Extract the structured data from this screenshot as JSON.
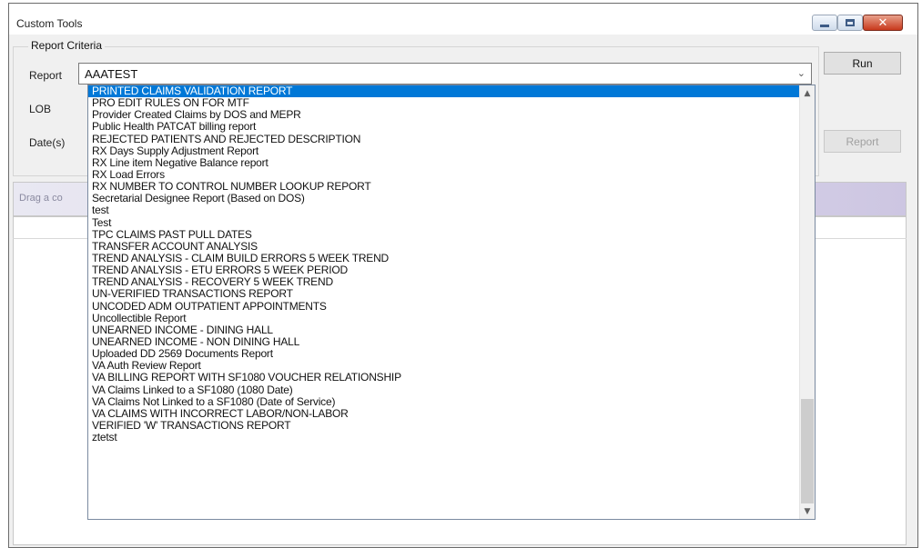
{
  "window": {
    "title": "Custom Tools"
  },
  "criteria": {
    "group_title": "Report Criteria",
    "report_label": "Report",
    "lob_label": "LOB",
    "dates_label": "Date(s)",
    "report_value": "AAATEST"
  },
  "buttons": {
    "run": "Run",
    "report": "Report"
  },
  "grid": {
    "drag_hint": "Drag a co"
  },
  "dropdown": {
    "items": [
      "PRINTED CLAIMS VALIDATION REPORT",
      "PRO EDIT RULES ON FOR MTF",
      "Provider Created Claims by DOS and MEPR",
      "Public Health PATCAT billing report",
      "REJECTED PATIENTS AND REJECTED DESCRIPTION",
      "RX Days Supply Adjustment Report",
      "RX Line item Negative Balance report",
      "RX Load Errors",
      "RX NUMBER TO CONTROL NUMBER LOOKUP REPORT",
      "Secretarial Designee Report (Based on DOS)",
      "test",
      "Test",
      "TPC CLAIMS PAST PULL DATES",
      "TRANSFER ACCOUNT ANALYSIS",
      "TREND ANALYSIS - CLAIM BUILD ERRORS 5 WEEK TREND",
      "TREND ANALYSIS - ETU ERRORS 5 WEEK PERIOD",
      "TREND ANALYSIS - RECOVERY 5 WEEK TREND",
      "UN-VERIFIED TRANSACTIONS REPORT",
      "UNCODED ADM OUTPATIENT APPOINTMENTS",
      "Uncollectible Report",
      "UNEARNED INCOME - DINING HALL",
      "UNEARNED INCOME - NON DINING HALL",
      "Uploaded DD 2569 Documents Report",
      "VA Auth Review Report",
      "VA BILLING REPORT WITH SF1080 VOUCHER RELATIONSHIP",
      "VA Claims Linked to a SF1080 (1080 Date)",
      "VA Claims Not Linked to a SF1080 (Date of Service)",
      "VA CLAIMS WITH INCORRECT LABOR/NON-LABOR",
      "VERIFIED 'W' TRANSACTIONS REPORT",
      "ztetst"
    ],
    "selected_index": 0
  },
  "colors": {
    "selection": "#0078d7",
    "close_button": "#c8381c"
  },
  "icons": {
    "minimize": "minimize-icon",
    "maximize": "maximize-icon",
    "close": "close-icon",
    "combo_arrow": "chevron-down-icon",
    "scroll_up": "chevron-up-icon",
    "scroll_down": "chevron-down-icon"
  }
}
